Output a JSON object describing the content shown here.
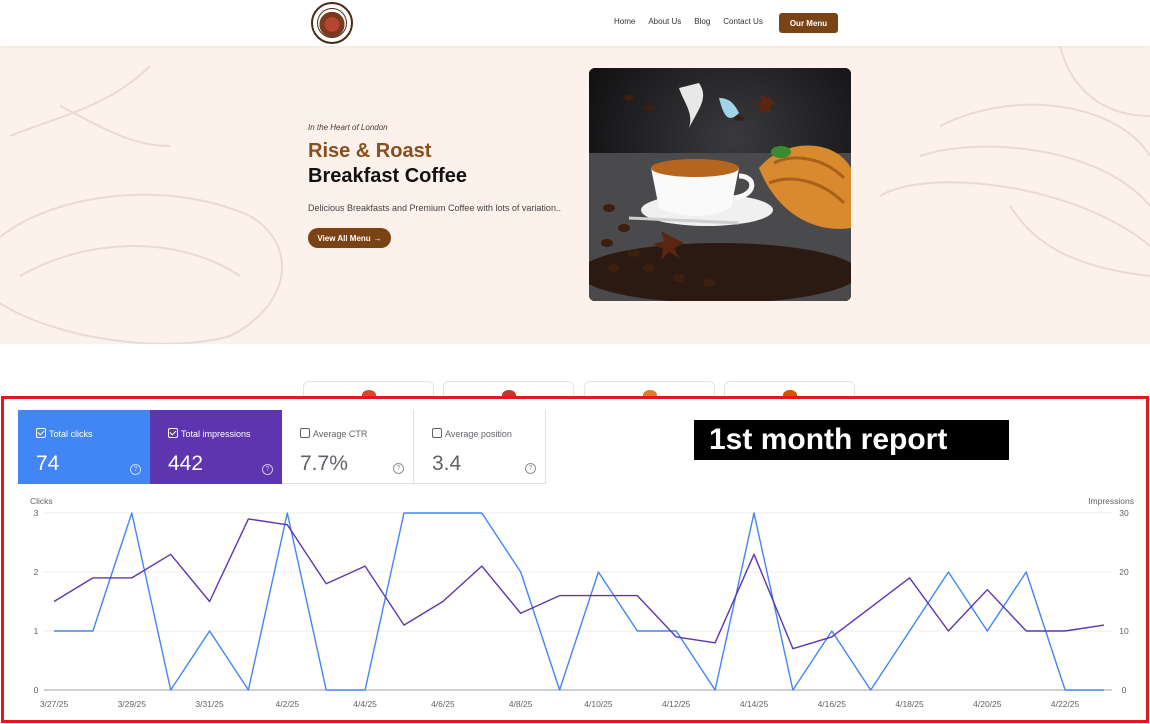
{
  "header": {
    "logo_icon": "rise-and-roast-logo",
    "nav": [
      "Home",
      "About Us",
      "Blog",
      "Contact Us"
    ],
    "cta": "Our Menu"
  },
  "hero": {
    "tagline": "In the Heart of London",
    "title_line1": "Rise & Roast",
    "title_line2": "Breakfast Coffee",
    "subtitle": "Delicious Breakfasts and Premium Coffee with lots of variation..",
    "button": "View All Menu",
    "button_icon": "arrow-right-icon",
    "image": "coffee-cup-croissant-photo"
  },
  "report": {
    "badge": "1st month report",
    "tiles": [
      {
        "label": "Total clicks",
        "value": "74",
        "checked": true
      },
      {
        "label": "Total impressions",
        "value": "442",
        "checked": true
      },
      {
        "label": "Average CTR",
        "value": "7.7%",
        "checked": false
      },
      {
        "label": "Average position",
        "value": "3.4",
        "checked": false
      }
    ],
    "help_icon": "?"
  },
  "colors": {
    "brand_brown": "#7a4316",
    "title_brown": "#8a4e1c",
    "hero_bg": "#fcf1eb",
    "clicks": "#4285f4",
    "impressions": "#5e35b1",
    "report_border": "#e01a1a"
  },
  "chart_data": {
    "type": "line",
    "x": [
      "3/27/25",
      "3/28/25",
      "3/29/25",
      "3/30/25",
      "3/31/25",
      "4/1/25",
      "4/2/25",
      "4/3/25",
      "4/4/25",
      "4/5/25",
      "4/6/25",
      "4/7/25",
      "4/8/25",
      "4/9/25",
      "4/10/25",
      "4/11/25",
      "4/12/25",
      "4/13/25",
      "4/14/25",
      "4/15/25",
      "4/16/25",
      "4/17/25",
      "4/18/25",
      "4/19/25",
      "4/20/25",
      "4/21/25",
      "4/22/25",
      "4/23/25"
    ],
    "x_tick_labels": [
      "3/27/25",
      "3/29/25",
      "3/31/25",
      "4/2/25",
      "4/4/25",
      "4/6/25",
      "4/8/25",
      "4/10/25",
      "4/12/25",
      "4/14/25",
      "4/16/25",
      "4/18/25",
      "4/20/25",
      "4/22/25"
    ],
    "series": [
      {
        "name": "Clicks",
        "axis": "left",
        "color": "#4285f4",
        "values": [
          1,
          1,
          3,
          0,
          1,
          0,
          3,
          0,
          0,
          3,
          3,
          3,
          2,
          0,
          2,
          1,
          1,
          0,
          3,
          0,
          1,
          0,
          1,
          2,
          1,
          2,
          0,
          0
        ]
      },
      {
        "name": "Impressions",
        "axis": "right",
        "color": "#5e35b1",
        "values": [
          15,
          19,
          19,
          23,
          15,
          29,
          28,
          18,
          21,
          11,
          15,
          21,
          13,
          16,
          16,
          16,
          9,
          8,
          23,
          7,
          9,
          14,
          19,
          10,
          17,
          10,
          10,
          11
        ]
      }
    ],
    "ylabel_left": "Clicks",
    "ylabel_right": "Impressions",
    "ylim_left": [
      0,
      3
    ],
    "ylim_right": [
      0,
      30
    ],
    "yticks_left": [
      "0",
      "1",
      "2",
      "3"
    ],
    "yticks_right": [
      "0",
      "10",
      "20",
      "30"
    ],
    "grid": true
  }
}
